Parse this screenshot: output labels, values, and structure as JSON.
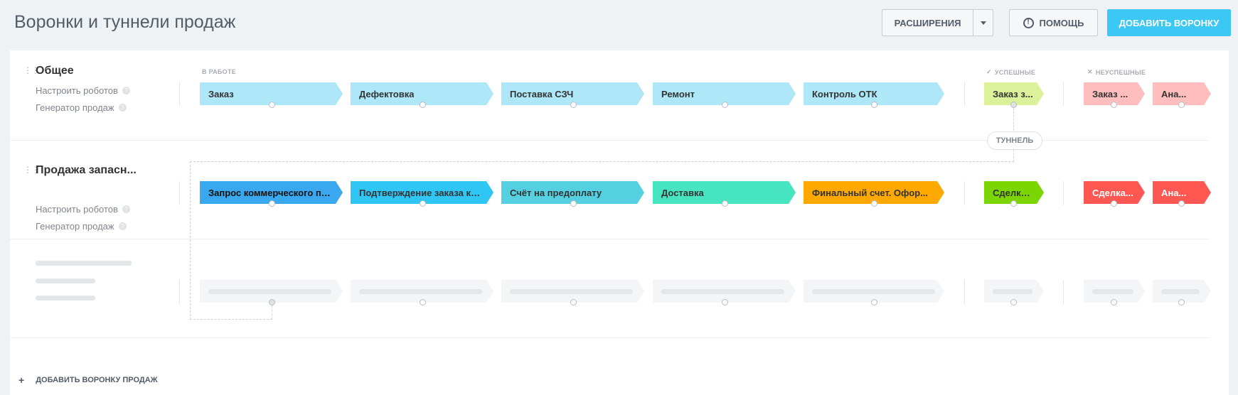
{
  "header": {
    "title": "Воронки и туннели продаж",
    "extensions_label": "Расширения",
    "help_label": "Помощь",
    "add_funnel_label": "Добавить воронку"
  },
  "groups": {
    "in_work": "В работе",
    "success": "Успешные",
    "fail": "Неуспешные"
  },
  "funnels": [
    {
      "name": "Общее",
      "robots_label": "Настроить роботов",
      "generator_label": "Генератор продаж",
      "stages": [
        {
          "label": "Заказ",
          "color": "#ade7f8"
        },
        {
          "label": "Дефектовка",
          "color": "#ade7f8"
        },
        {
          "label": "Поставка СЗЧ",
          "color": "#ade7f8"
        },
        {
          "label": "Ремонт",
          "color": "#ade7f8"
        },
        {
          "label": "Контроль ОТК",
          "color": "#ade7f8"
        }
      ],
      "success_stage": {
        "label": "Заказ з...",
        "color": "#dcf19a"
      },
      "fail_stages": [
        {
          "label": "Заказ ...",
          "color": "#ffbebd"
        },
        {
          "label": "Ана...",
          "color": "#ffbebd"
        }
      ]
    },
    {
      "name": "Продажа запасн...",
      "robots_label": "Настроить роботов",
      "generator_label": "Генератор продаж",
      "stages": [
        {
          "label": "Запрос коммерческого пр...",
          "color": "#39a8ef"
        },
        {
          "label": "Подтверждение заказа кл...",
          "color": "#2fc6f6"
        },
        {
          "label": "Счёт на предоплату",
          "color": "#55d0e0"
        },
        {
          "label": "Доставка",
          "color": "#47e4c2"
        },
        {
          "label": "Финальный счет. Офор...",
          "color": "#ffa900"
        }
      ],
      "success_stage": {
        "label": "Сделка ...",
        "color": "#7bd500"
      },
      "fail_stages": [
        {
          "label": "Сделка...",
          "color": "#ff5752"
        },
        {
          "label": "Ана...",
          "color": "#ff5752"
        }
      ]
    }
  ],
  "tunnel_label": "Туннель",
  "footer": {
    "add_label": "Добавить воронку продаж",
    "plus": "+"
  }
}
